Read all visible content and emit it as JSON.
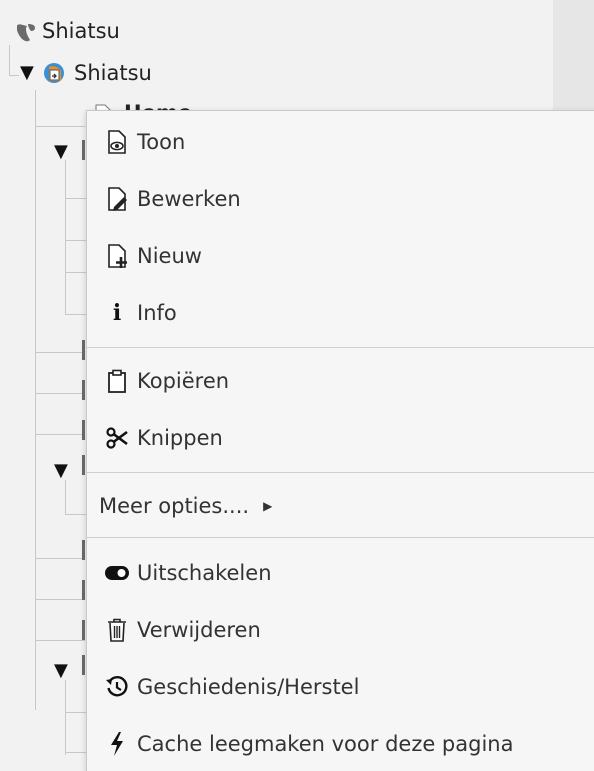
{
  "tree": {
    "root_label": "Shiatsu",
    "site_label": "Shiatsu",
    "home_label": "Home"
  },
  "context_menu": {
    "items": [
      {
        "label": "Toon",
        "icon": "page-view-icon"
      },
      {
        "label": "Bewerken",
        "icon": "page-edit-icon"
      },
      {
        "label": "Nieuw",
        "icon": "page-new-icon"
      },
      {
        "label": "Info",
        "icon": "info-icon"
      },
      {
        "label": "Kopiëren",
        "icon": "clipboard-icon"
      },
      {
        "label": "Knippen",
        "icon": "scissors-icon"
      },
      {
        "label": "Meer opties....",
        "icon": "caret-right-icon"
      },
      {
        "label": "Uitschakelen",
        "icon": "toggle-icon"
      },
      {
        "label": "Verwijderen",
        "icon": "trash-icon"
      },
      {
        "label": "Geschiedenis/Herstel",
        "icon": "history-icon"
      },
      {
        "label": "Cache leegmaken voor deze pagina",
        "icon": "bolt-icon"
      }
    ]
  }
}
